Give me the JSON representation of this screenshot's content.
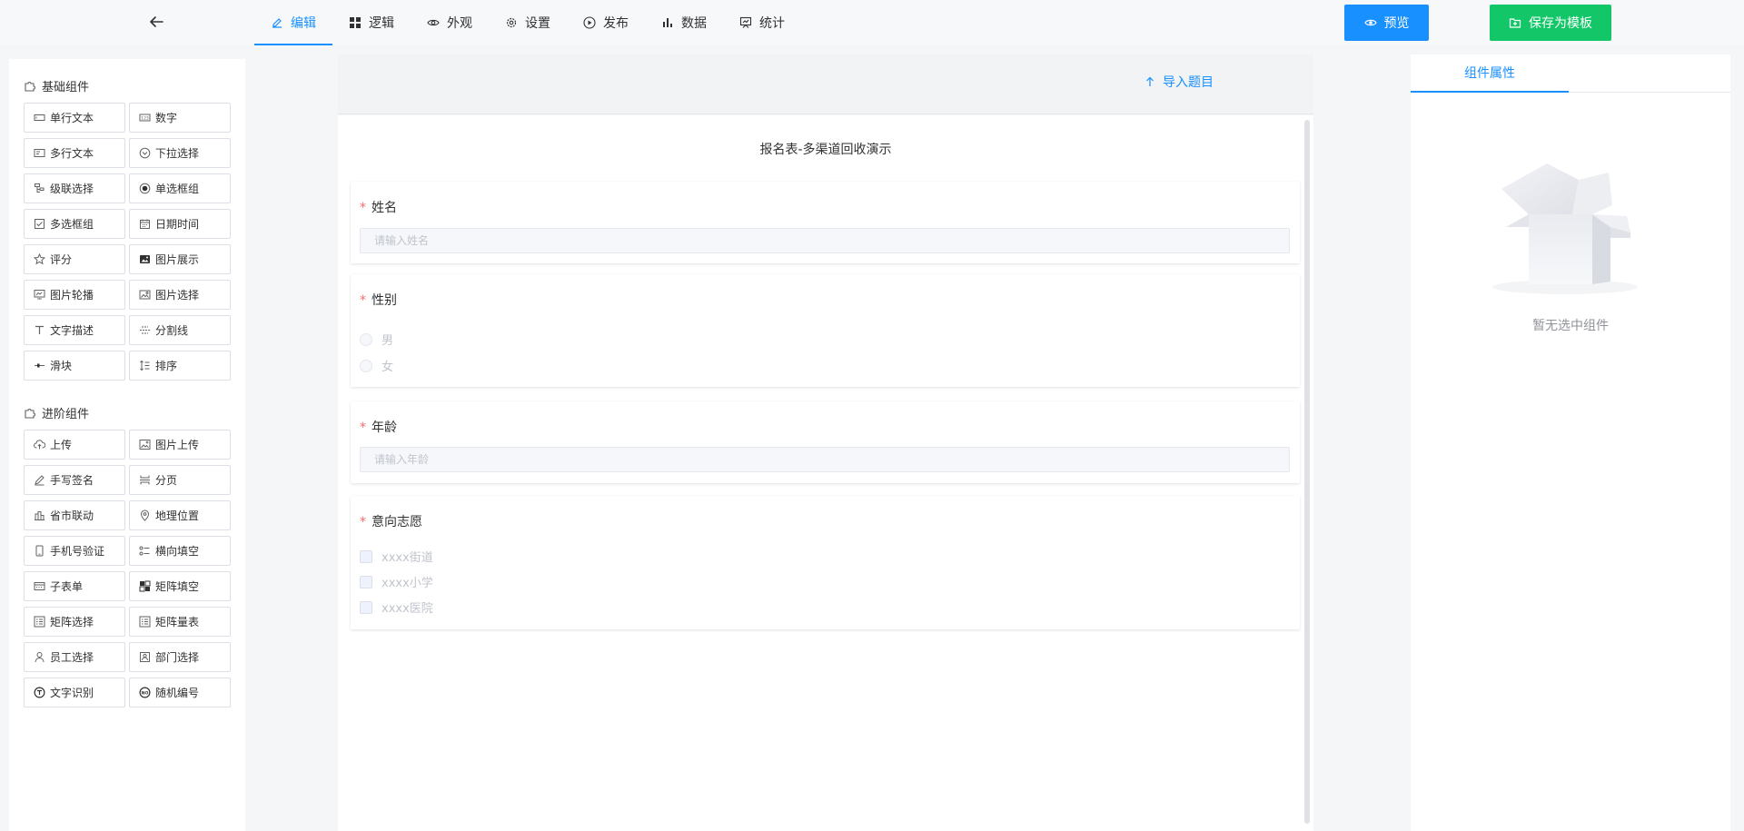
{
  "header": {
    "nav": [
      {
        "label": "编辑",
        "icon": "edit-icon",
        "active": true
      },
      {
        "label": "逻辑",
        "icon": "logic-icon"
      },
      {
        "label": "外观",
        "icon": "eye-icon"
      },
      {
        "label": "设置",
        "icon": "gear-icon"
      },
      {
        "label": "发布",
        "icon": "play-icon"
      },
      {
        "label": "数据",
        "icon": "bar-chart-icon"
      },
      {
        "label": "统计",
        "icon": "statistics-icon"
      }
    ],
    "preview_label": "预览",
    "save_template_label": "保存为模板",
    "colors": {
      "accent": "#1890ff",
      "save": "#13c768"
    }
  },
  "palette": {
    "basic_title": "基础组件",
    "basic": [
      {
        "label": "单行文本",
        "icon": "single-line-icon"
      },
      {
        "label": "数字",
        "icon": "number-icon"
      },
      {
        "label": "多行文本",
        "icon": "multi-line-icon"
      },
      {
        "label": "下拉选择",
        "icon": "dropdown-icon"
      },
      {
        "label": "级联选择",
        "icon": "cascader-icon"
      },
      {
        "label": "单选框组",
        "icon": "radio-icon"
      },
      {
        "label": "多选框组",
        "icon": "checkbox-icon"
      },
      {
        "label": "日期时间",
        "icon": "calendar-icon"
      },
      {
        "label": "评分",
        "icon": "star-icon"
      },
      {
        "label": "图片展示",
        "icon": "image-icon"
      },
      {
        "label": "图片轮播",
        "icon": "carousel-icon"
      },
      {
        "label": "图片选择",
        "icon": "image-select-icon"
      },
      {
        "label": "文字描述",
        "icon": "text-icon"
      },
      {
        "label": "分割线",
        "icon": "divider-icon"
      },
      {
        "label": "滑块",
        "icon": "slider-icon"
      },
      {
        "label": "排序",
        "icon": "sort-icon"
      }
    ],
    "advanced_title": "进阶组件",
    "advanced": [
      {
        "label": "上传",
        "icon": "upload-icon"
      },
      {
        "label": "图片上传",
        "icon": "image-upload-icon"
      },
      {
        "label": "手写签名",
        "icon": "signature-icon"
      },
      {
        "label": "分页",
        "icon": "pagination-icon"
      },
      {
        "label": "省市联动",
        "icon": "city-icon"
      },
      {
        "label": "地理位置",
        "icon": "location-icon"
      },
      {
        "label": "手机号验证",
        "icon": "phone-icon"
      },
      {
        "label": "横向填空",
        "icon": "fill-blank-icon"
      },
      {
        "label": "子表单",
        "icon": "subform-icon"
      },
      {
        "label": "矩阵填空",
        "icon": "matrix-fill-icon"
      },
      {
        "label": "矩阵选择",
        "icon": "matrix-select-icon"
      },
      {
        "label": "矩阵量表",
        "icon": "matrix-scale-icon"
      },
      {
        "label": "员工选择",
        "icon": "user-icon"
      },
      {
        "label": "部门选择",
        "icon": "department-icon"
      },
      {
        "label": "文字识别",
        "icon": "ocr-icon"
      },
      {
        "label": "随机编号",
        "icon": "random-number-icon"
      }
    ]
  },
  "canvas": {
    "import_label": "导入题目",
    "form_title": "报名表-多渠道回收演示",
    "questions": [
      {
        "label": "姓名",
        "required": "*",
        "placeholder": "请输入姓名"
      },
      {
        "label": "性别",
        "required": "*",
        "options": [
          "男",
          "女"
        ]
      },
      {
        "label": "年龄",
        "required": "*",
        "placeholder": "请输入年龄"
      },
      {
        "label": "意向志愿",
        "required": "*",
        "options": [
          "xxxx街道",
          "xxxx小学",
          "xxxx医院"
        ]
      }
    ]
  },
  "right": {
    "tab_label": "组件属性",
    "empty_text": "暂无选中组件"
  }
}
